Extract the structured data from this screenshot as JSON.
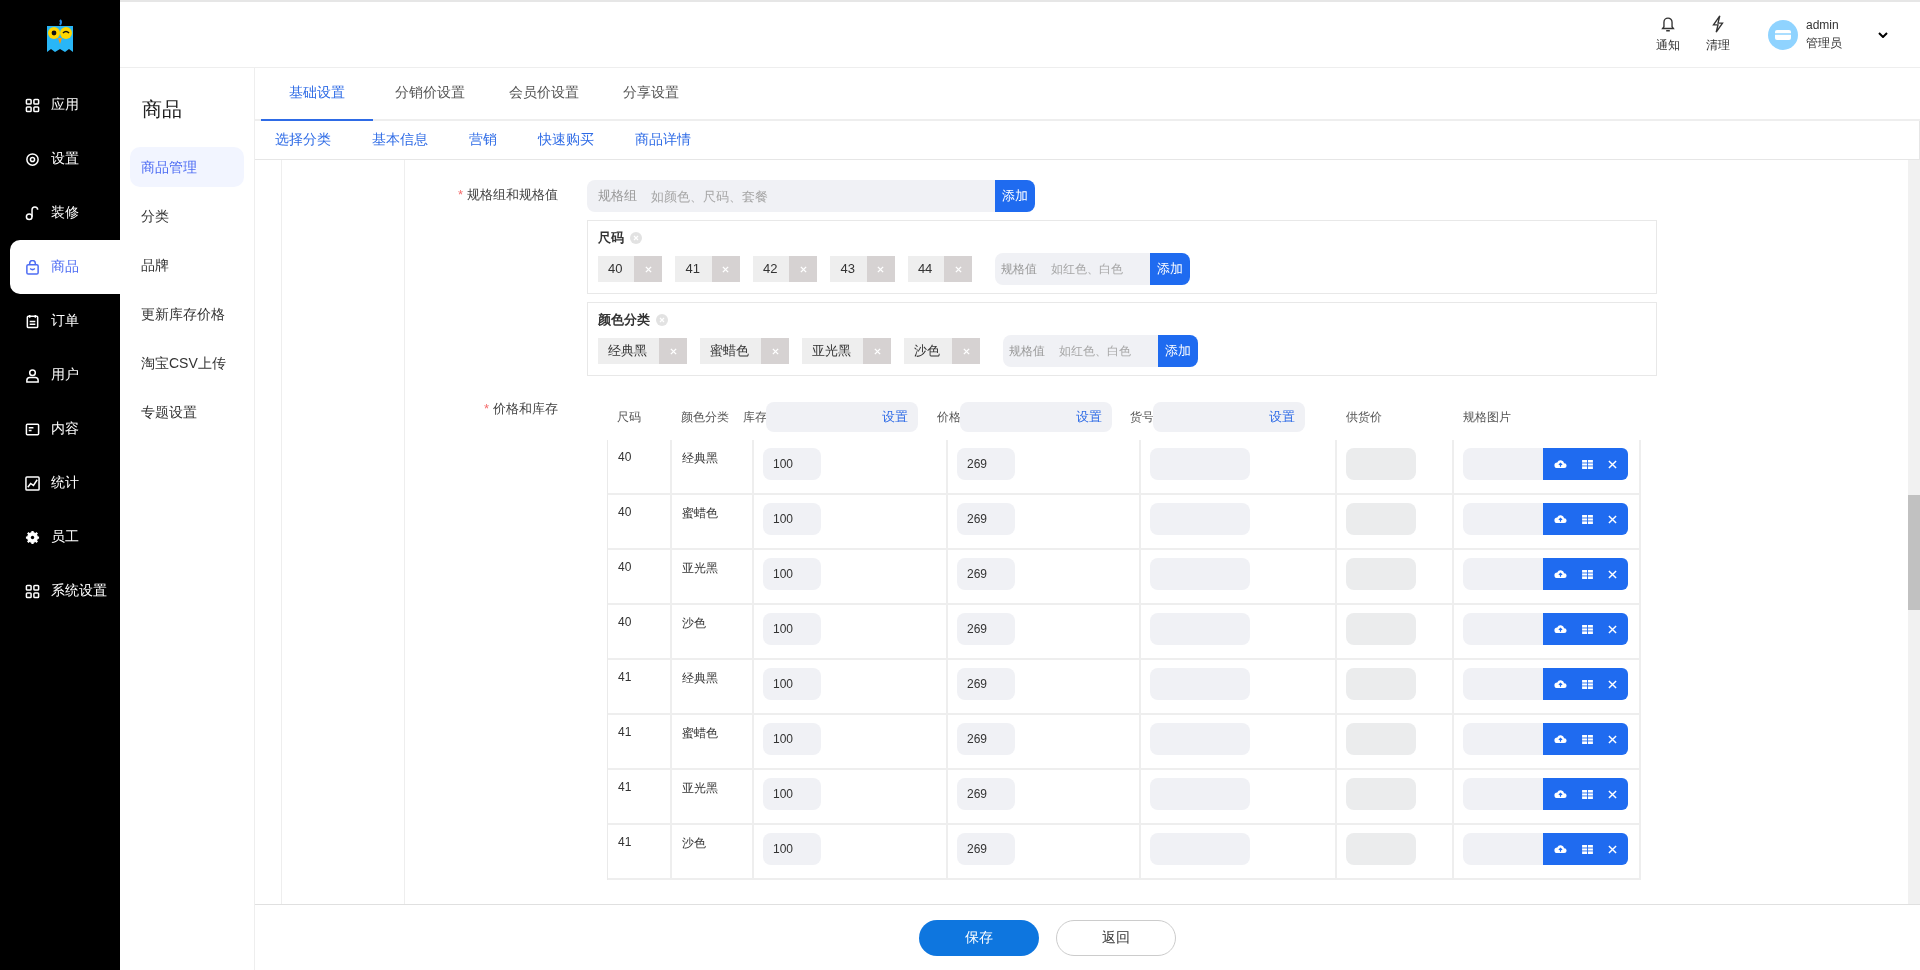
{
  "header": {
    "actions": [
      {
        "label": "通知",
        "kind": "bell"
      },
      {
        "label": "清理",
        "kind": "bolt"
      }
    ],
    "user": {
      "name": "admin",
      "role": "管理员"
    }
  },
  "nav": [
    {
      "label": "应用",
      "kind": "grid",
      "selected": false
    },
    {
      "label": "设置",
      "kind": "gear",
      "selected": false
    },
    {
      "label": "装修",
      "kind": "brush",
      "selected": false
    },
    {
      "label": "商品",
      "kind": "bag",
      "selected": true
    },
    {
      "label": "订单",
      "kind": "calendar",
      "selected": false
    },
    {
      "label": "用户",
      "kind": "user",
      "selected": false
    },
    {
      "label": "内容",
      "kind": "content",
      "selected": false
    },
    {
      "label": "统计",
      "kind": "chart",
      "selected": false
    },
    {
      "label": "员工",
      "kind": "cog",
      "selected": false
    },
    {
      "label": "系统设置",
      "kind": "grid",
      "selected": false
    }
  ],
  "subnav": {
    "title": "商品",
    "items": [
      {
        "label": "商品管理",
        "selected": true
      },
      {
        "label": "分类",
        "selected": false
      },
      {
        "label": "品牌",
        "selected": false
      },
      {
        "label": "更新库存价格",
        "selected": false
      },
      {
        "label": "淘宝CSV上传",
        "selected": false
      },
      {
        "label": "专题设置",
        "selected": false
      }
    ]
  },
  "tabs": [
    {
      "label": "基础设置",
      "selected": true
    },
    {
      "label": "分销价设置",
      "selected": false
    },
    {
      "label": "会员价设置",
      "selected": false
    },
    {
      "label": "分享设置",
      "selected": false
    }
  ],
  "section_links": [
    "选择分类",
    "基本信息",
    "营销",
    "快速购买",
    "商品详情"
  ],
  "spec": {
    "label": "规格组和规格值",
    "required_mark": "*",
    "prefix": "规格组",
    "placeholder": "如颜色、尺码、套餐",
    "add": "添加",
    "groups": [
      {
        "name": "尺码",
        "values": [
          "40",
          "41",
          "42",
          "43",
          "44"
        ],
        "prefix": "规格值",
        "placeholder": "如红色、白色",
        "add": "添加"
      },
      {
        "name": "颜色分类",
        "values": [
          "经典黑",
          "蜜蜡色",
          "亚光黑",
          "沙色"
        ],
        "prefix": "规格值",
        "placeholder": "如红色、白色",
        "add": "添加"
      }
    ]
  },
  "price_stock": {
    "label": "价格和库存",
    "required_mark": "*",
    "columns": [
      {
        "label": "尺码"
      },
      {
        "label": "颜色分类"
      },
      {
        "label": "库存",
        "batch": "设置"
      },
      {
        "label": "价格",
        "batch": "设置"
      },
      {
        "label": "货号",
        "batch": "设置"
      },
      {
        "label": "供货价"
      },
      {
        "label": "规格图片"
      }
    ],
    "rows": [
      {
        "size": "40",
        "color_class": "经典黑",
        "stock": "100",
        "price": "269"
      },
      {
        "size": "40",
        "color_class": "蜜蜡色",
        "stock": "100",
        "price": "269"
      },
      {
        "size": "40",
        "color_class": "亚光黑",
        "stock": "100",
        "price": "269"
      },
      {
        "size": "40",
        "color_class": "沙色",
        "stock": "100",
        "price": "269"
      },
      {
        "size": "41",
        "color_class": "经典黑",
        "stock": "100",
        "price": "269"
      },
      {
        "size": "41",
        "color_class": "蜜蜡色",
        "stock": "100",
        "price": "269"
      },
      {
        "size": "41",
        "color_class": "亚光黑",
        "stock": "100",
        "price": "269"
      },
      {
        "size": "41",
        "color_class": "沙色",
        "stock": "100",
        "price": "269"
      }
    ]
  },
  "footer": {
    "save": "保存",
    "back": "返回"
  }
}
